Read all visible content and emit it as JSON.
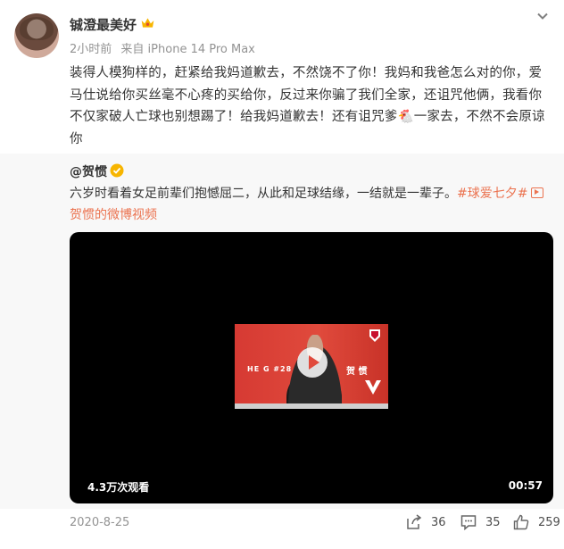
{
  "post": {
    "author": "铖澄最美好",
    "time": "2小时前",
    "source": "来自 iPhone 14 Pro Max",
    "text": "装得人模狗样的，赶紧给我妈道歉去，不然饶不了你！我妈和我爸怎么对的你，爱马仕说给你买丝毫不心疼的买给你，反过来你骗了我们全家，还诅咒他俩，我看你不仅家破人亡球也别想踢了！给我妈道歉去！还有诅咒爹🐔一家去，不然不会原谅你",
    "date": "2020-8-25",
    "shares": "36",
    "comments": "35",
    "likes": "259"
  },
  "repost": {
    "author": "@贺惯",
    "text": "六岁时看着女足前辈们抱憾屈二，从此和足球结缘，一结就是一辈子。",
    "hashtag": "#球爱七夕#",
    "video_link": "贺惯的微博视频",
    "video": {
      "views": "4.3万次观看",
      "duration": "00:57",
      "thumb_name": "HE G #28",
      "thumb_cn": "贺 惯"
    }
  },
  "icons": [
    "crown-icon",
    "more-icon",
    "verified-badge-icon",
    "video-link-icon",
    "play-icon",
    "share-icon",
    "comment-icon",
    "like-icon"
  ],
  "colors": {
    "link": "#eb7350",
    "meta": "#939393",
    "repost_bg": "#f8f8f8",
    "badge": "#f7b500"
  }
}
